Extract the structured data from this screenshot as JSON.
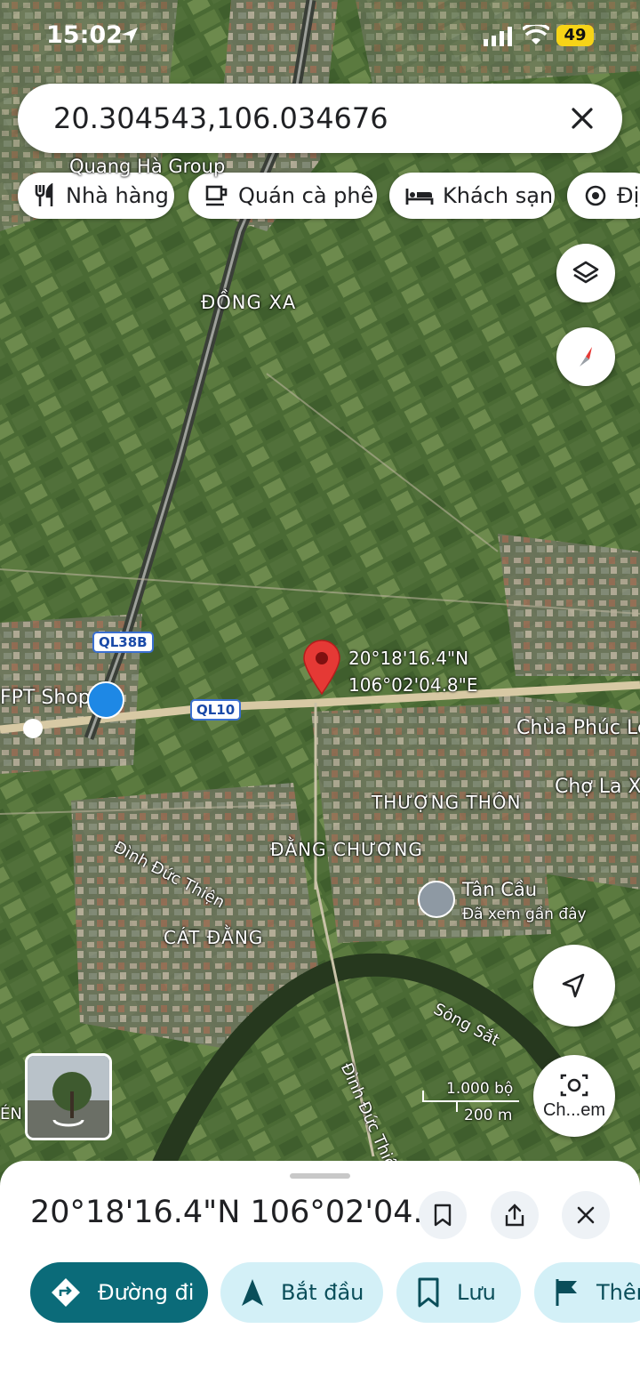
{
  "status": {
    "time": "15:02",
    "battery": "49"
  },
  "search": {
    "query": "20.304543,106.034676"
  },
  "chips": [
    {
      "label": "Nhà hàng",
      "icon": "fork-knife-icon"
    },
    {
      "label": "Quán cà phê",
      "icon": "coffee-cup-icon"
    },
    {
      "label": "Khách sạn",
      "icon": "bed-icon"
    },
    {
      "label": "Địa",
      "icon": "landmark-icon"
    }
  ],
  "map": {
    "labels": {
      "quang_ha": "Quang Hà Group",
      "dong_xa": "ĐỒNG XA",
      "fpt": "FPT Shop",
      "chua": "Chùa Phúc Lé",
      "cho": "Chợ La X",
      "thuong_thon": "THƯỢNG THÔN",
      "dang_chuong": "ĐẰNG CHƯƠNG",
      "tan_cau": "Tân Cầu",
      "tan_cau_sub": "Đã xem gần đây",
      "cat_dang": "CÁT ĐẰNG",
      "dinh_duc_thien_1": "Đình Đức Thiện",
      "dinh_duc_thien_2": "Đình Đức Thiện",
      "song_sat": "Sông Sắt",
      "edge_left": "ÉN"
    },
    "road_badges": {
      "ql38b": "QL38B",
      "ql10": "QL10"
    },
    "pin": {
      "lat": "20°18'16.4\"N",
      "lng": "106°02'04.8\"E",
      "color": "#e53935"
    },
    "scale": {
      "top": "1.000 bộ",
      "bottom": "200 m"
    },
    "camera_label": "Ch...em"
  },
  "sheet": {
    "title": "20°18'16.4\"N 106°02'04...",
    "actions": [
      {
        "label": "Đường đi",
        "icon": "directions-icon"
      },
      {
        "label": "Bắt đầu",
        "icon": "navigation-arrow-icon"
      },
      {
        "label": "Lưu",
        "icon": "bookmark-icon"
      },
      {
        "label": "Thêm",
        "icon": "flag-icon"
      }
    ]
  },
  "colors": {
    "accent": "#0b6b79",
    "light_action": "#d3f0f7",
    "pin": "#e53935"
  }
}
